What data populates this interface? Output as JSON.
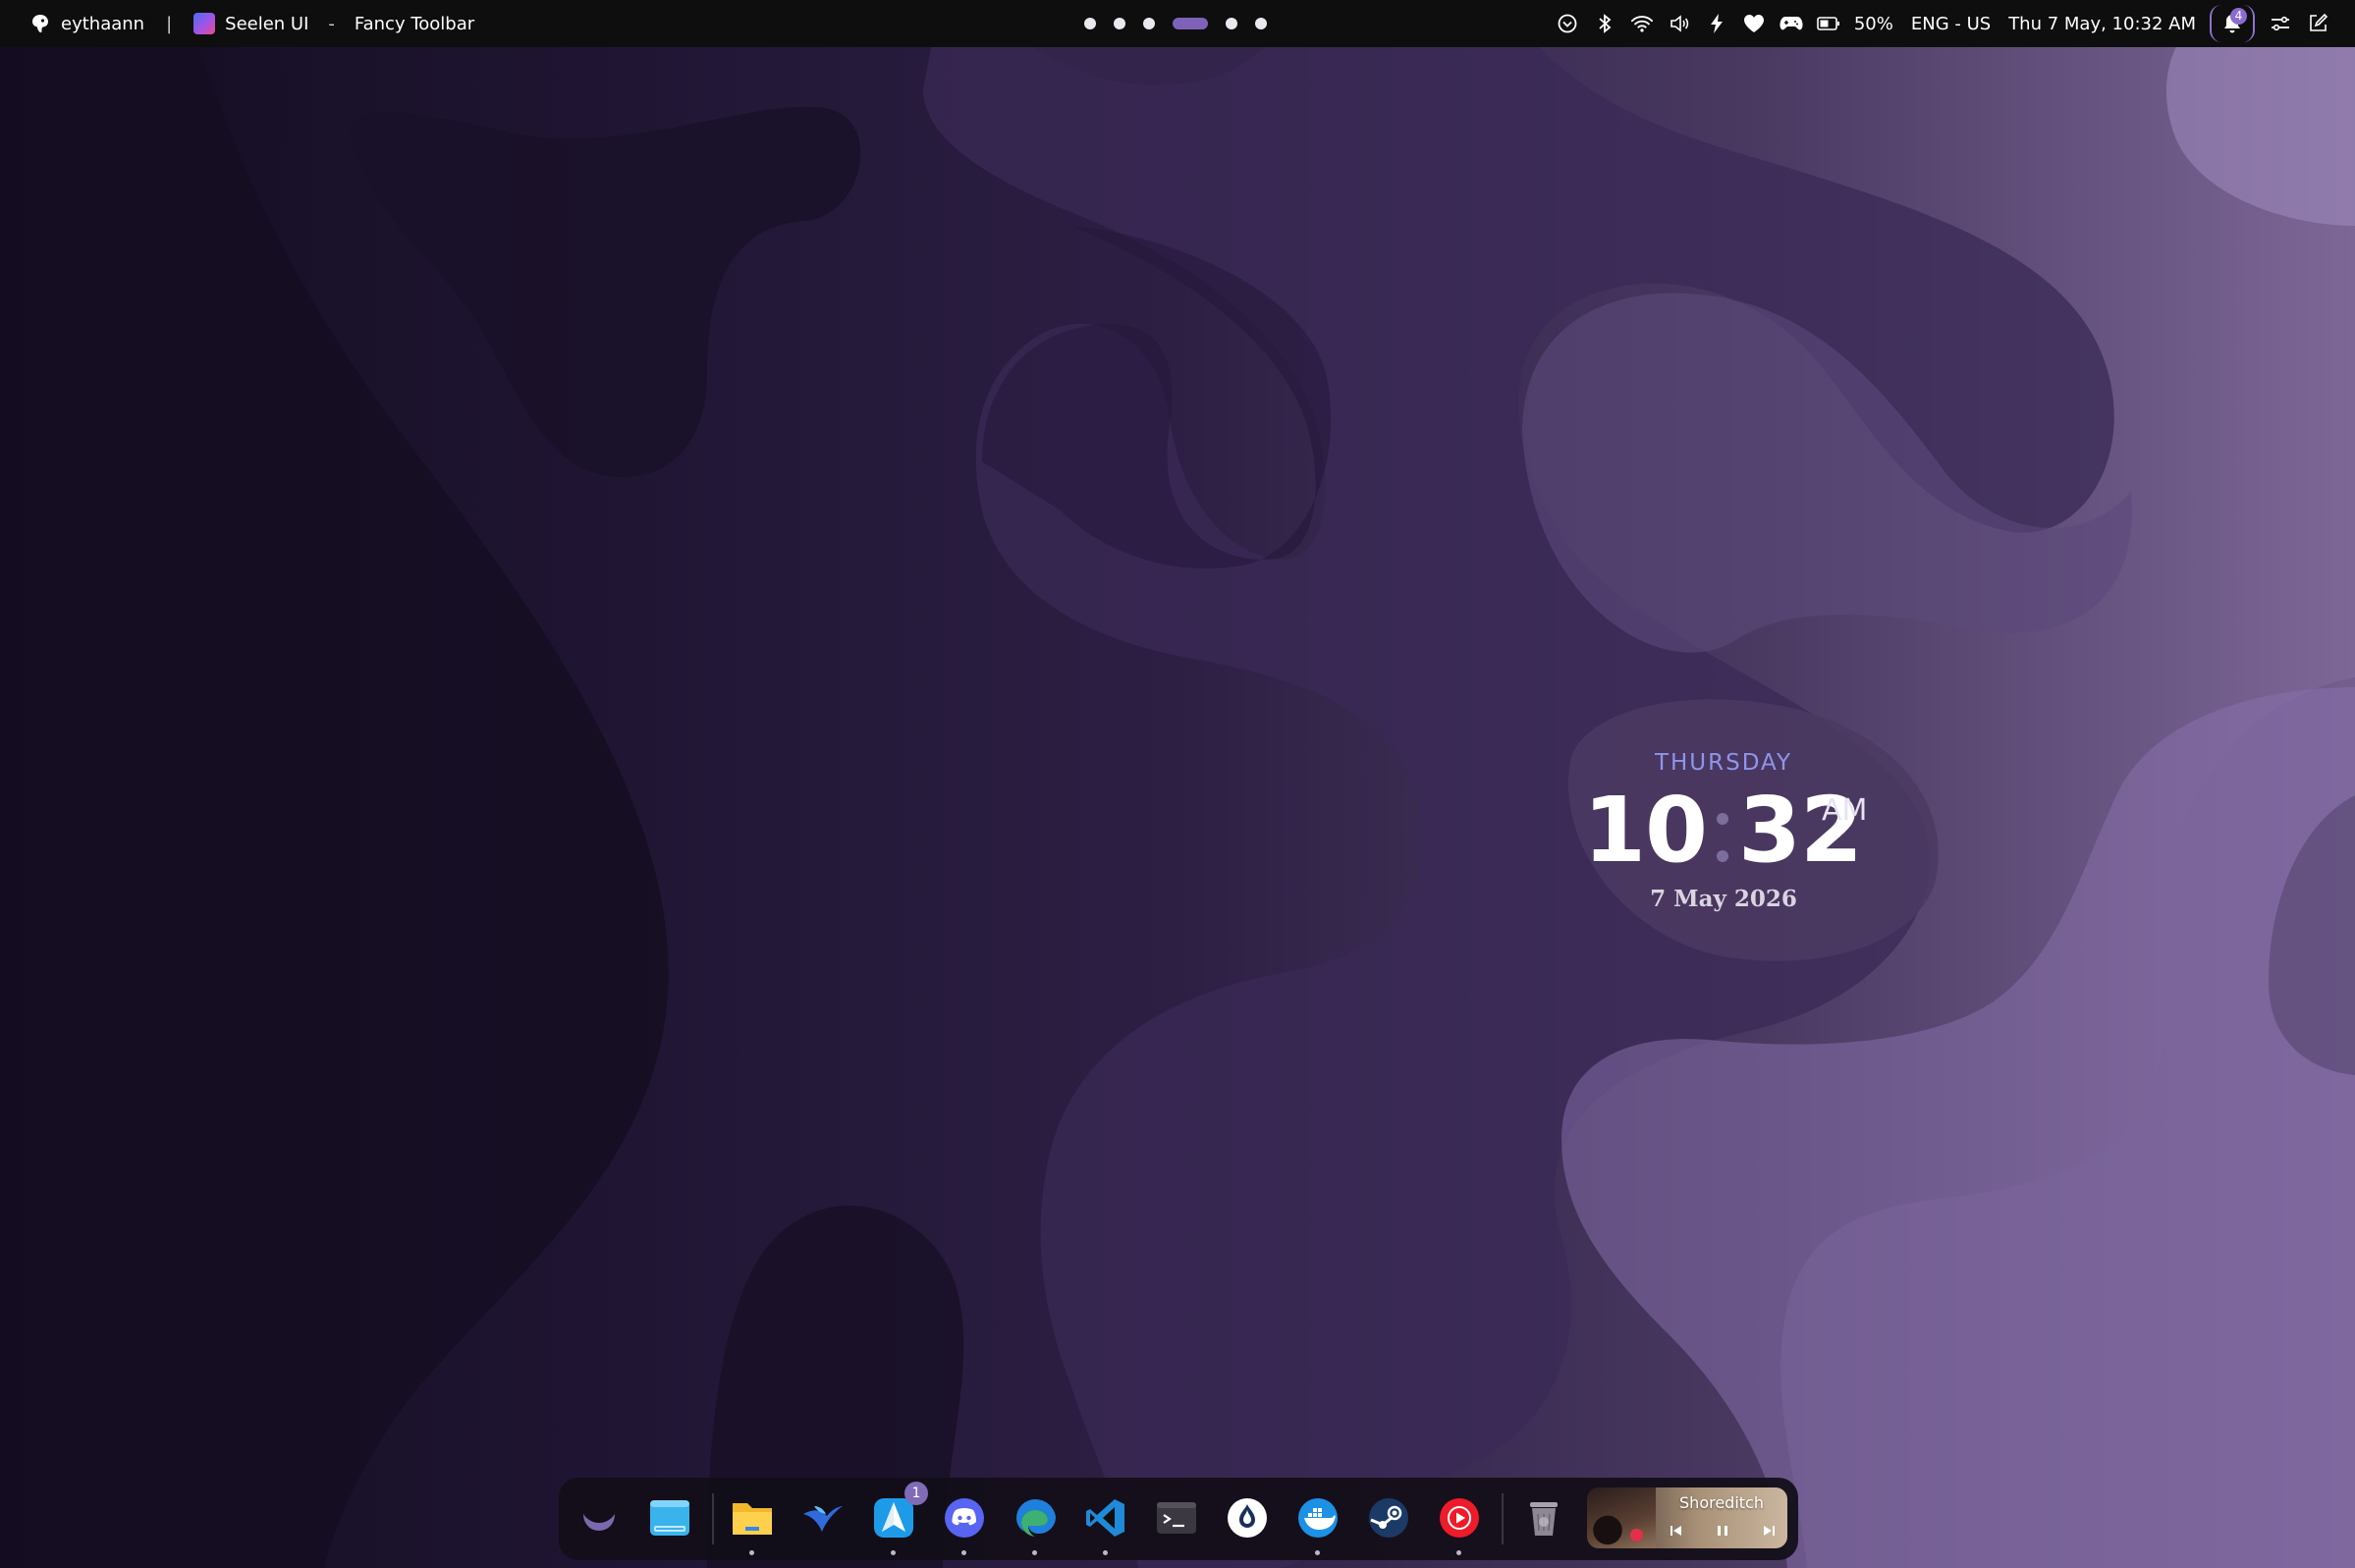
{
  "toolbar": {
    "user_name": "eythaann",
    "separator": "|",
    "app_name": "Seelen UI",
    "dash": "-",
    "window_title": "Fancy Toolbar",
    "workspaces": {
      "count": 6,
      "active_index": 3
    },
    "battery_percent": "50%",
    "language": "ENG - US",
    "datetime": "Thu 7 May, 10:32 AM",
    "notification_count": "4"
  },
  "clock_widget": {
    "day": "THURSDAY",
    "hours": "10",
    "minutes": "32",
    "ampm": "AM",
    "date": "7 May 2026"
  },
  "dock": {
    "items": [
      {
        "name": "seelen-launcher",
        "icon": "seelen-icon"
      },
      {
        "name": "desktop",
        "icon": "desktop-icon"
      },
      {
        "name": "file-explorer",
        "icon": "folder-icon",
        "running": true
      },
      {
        "name": "arc-browser",
        "icon": "bird-icon"
      },
      {
        "name": "spark-mail",
        "icon": "paper-plane-icon",
        "badge": "1",
        "running": true
      },
      {
        "name": "discord",
        "icon": "discord-icon",
        "running": true
      },
      {
        "name": "edge",
        "icon": "edge-icon",
        "running": true
      },
      {
        "name": "vscode",
        "icon": "vscode-icon",
        "running": true
      },
      {
        "name": "terminal",
        "icon": "terminal-icon"
      },
      {
        "name": "tor-browser",
        "icon": "onion-icon"
      },
      {
        "name": "docker",
        "icon": "docker-icon",
        "running": true
      },
      {
        "name": "steam",
        "icon": "steam-icon"
      },
      {
        "name": "youtube-music",
        "icon": "youtube-music-icon",
        "running": true
      },
      {
        "name": "recycle-bin",
        "icon": "trash-icon"
      }
    ],
    "media": {
      "title": "Shoreditch"
    }
  },
  "colors": {
    "toolbar_bg": "#0e0e0f",
    "accent": "#7e62b8",
    "clock_day": "#8e95ea",
    "wallpaper_dark": "#140d22",
    "wallpaper_light": "#8a72ad"
  }
}
